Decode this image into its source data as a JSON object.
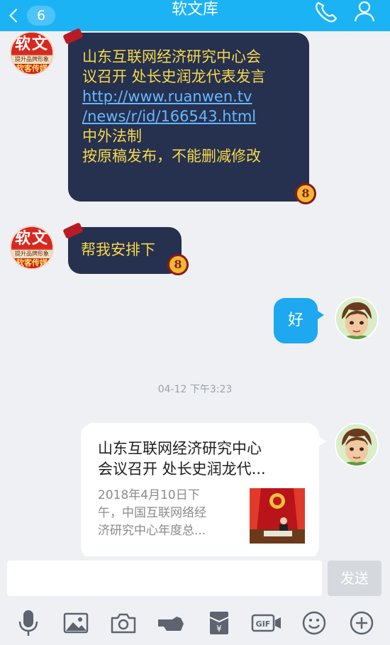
{
  "header": {
    "title": "软文库",
    "unread_count": "6"
  },
  "messages": [
    {
      "id": "m1",
      "line1": "山东互联网经济研究中心会",
      "line2": "议召开 处长史润龙代表发言",
      "link1": "http://www.ruanwen.tv",
      "link2": "/news/r/id/166543.html",
      "line3": "中外法制",
      "line4": "按原稿发布，不能删减修改"
    },
    {
      "id": "m2",
      "text": "帮我安排下"
    },
    {
      "id": "m3",
      "text": "好"
    }
  ],
  "avatar_text": {
    "big": "软文",
    "small": "提升品牌形象",
    "bottom": "软客传媒"
  },
  "timestamp": "04-12 下午3:23",
  "card": {
    "title_line1": "山东互联网经济研究中心",
    "title_line2": "会议召开 处长史润龙代...",
    "desc_line1": "2018年4月10日下",
    "desc_line2": "午，中国互联网络经",
    "desc_line3": "济研究中心年度总..."
  },
  "composer": {
    "send_label": "发送",
    "input_value": ""
  },
  "toolbar_icons": [
    "microphone-icon",
    "image-icon",
    "camera-icon",
    "poke-icon",
    "red-packet-icon",
    "gif-icon",
    "emoji-icon",
    "plus-icon"
  ],
  "colors": {
    "header": "#1cb3f5",
    "dark_bubble": "#26304f",
    "bubble_text": "#f6d94a",
    "link": "#66b8ff",
    "my_bubble": "#1da8f0"
  }
}
